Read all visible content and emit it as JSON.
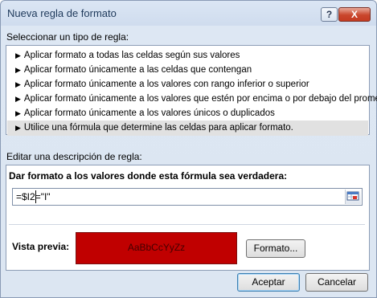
{
  "dialog": {
    "title": "Nueva regla de formato",
    "help_label": "?",
    "close_label": "X"
  },
  "rule_type": {
    "label": "Seleccionar un tipo de regla:",
    "items": [
      {
        "label": "Aplicar formato a todas las celdas según sus valores",
        "selected": false
      },
      {
        "label": "Aplicar formato únicamente a las celdas que contengan",
        "selected": false
      },
      {
        "label": "Aplicar formato únicamente a los valores con rango inferior o superior",
        "selected": false
      },
      {
        "label": "Aplicar formato únicamente a los valores que estén por encima o por debajo del promedio",
        "selected": false
      },
      {
        "label": "Aplicar formato únicamente a los valores únicos o duplicados",
        "selected": false
      },
      {
        "label": "Utilice una fórmula que determine las celdas para aplicar formato.",
        "selected": true
      }
    ]
  },
  "description": {
    "label": "Editar una descripción de regla:",
    "formula_label": "Dar formato a los valores donde esta fórmula sea verdadera:",
    "formula_value": "=$I2=\"I\""
  },
  "preview": {
    "label": "Vista previa:",
    "sample_text": "AaBbCcYyZz",
    "fill_color": "#c00000",
    "format_button": "Formato..."
  },
  "buttons": {
    "accept": "Aceptar",
    "cancel": "Cancelar"
  }
}
